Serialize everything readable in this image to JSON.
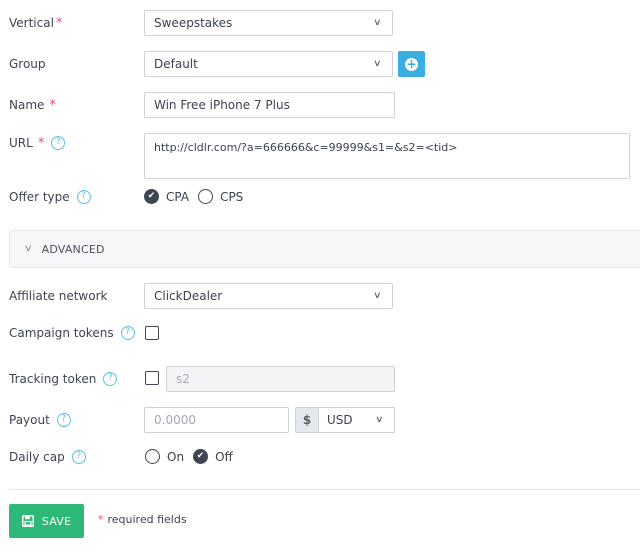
{
  "form": {
    "vertical": {
      "label": "Vertical",
      "required_mark": "*",
      "value": "Sweepstakes"
    },
    "group": {
      "label": "Group",
      "value": "Default",
      "add_icon": "plus-circle-icon"
    },
    "name": {
      "label": "Name",
      "required_mark": "*",
      "value": "Win Free iPhone 7 Plus"
    },
    "url": {
      "label": "URL",
      "required_mark": "*",
      "help_icon": "?",
      "value": "http://cldlr.com/?a=666666&c=99999&s1=&s2=<tid>"
    },
    "offer_type": {
      "label": "Offer type",
      "help_icon": "?",
      "options": [
        {
          "label": "CPA",
          "selected": true
        },
        {
          "label": "CPS",
          "selected": false
        }
      ]
    },
    "advanced": {
      "label": "ADVANCED",
      "expanded": true
    },
    "affiliate_network": {
      "label": "Affiliate network",
      "value": "ClickDealer"
    },
    "campaign_tokens": {
      "label": "Campaign tokens",
      "help_icon": "?",
      "checked": false
    },
    "tracking_token": {
      "label": "Tracking token",
      "help_icon": "?",
      "checked": false,
      "placeholder": "s2"
    },
    "payout": {
      "label": "Payout",
      "help_icon": "?",
      "placeholder": "0.0000",
      "currency_symbol": "$",
      "currency": "USD"
    },
    "daily_cap": {
      "label": "Daily cap",
      "help_icon": "?",
      "options": [
        {
          "label": "On",
          "selected": false
        },
        {
          "label": "Off",
          "selected": true
        }
      ]
    }
  },
  "footer": {
    "save_label": "SAVE",
    "required_mark": "*",
    "required_note": "required fields"
  },
  "colors": {
    "primary_blue": "#3aaee1",
    "save_green": "#2fb978",
    "required_pink": "#e0527a",
    "help_cyan": "#5ec1de"
  }
}
